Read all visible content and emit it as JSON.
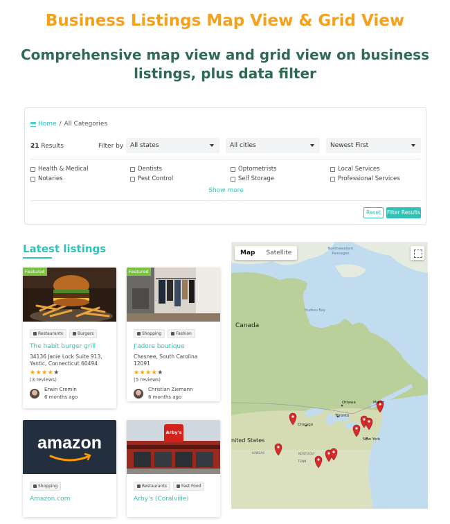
{
  "hero": {
    "title": "Business Listings Map View & Grid View",
    "subtitle": "Comprehensive map view and grid view on business listings, plus data filter"
  },
  "breadcrumb": {
    "home": "Home",
    "separator": "/",
    "current": "All Categories"
  },
  "filter": {
    "results_count": "21",
    "results_label": "Results",
    "filter_by_label": "Filter by",
    "states_value": "All states",
    "cities_value": "All cities",
    "sort_value": "Newest First",
    "categories": [
      "Health & Medical",
      "Dentists",
      "Optometrists",
      "Local Services",
      "Notaries",
      "Pest Control",
      "Self Storage",
      "Professional Services"
    ],
    "show_more": "Show more",
    "reset_label": "Reset",
    "filter_label": "Filter Results"
  },
  "latest": {
    "title": "Latest listings"
  },
  "listings": [
    {
      "featured": "Featured",
      "tags": [
        "Restaurants",
        "Burgers"
      ],
      "name": "The habit burger grill",
      "address": "34136 Janie Lock Suite 913, Yantic, Connecticut 60494",
      "rating": 4,
      "reviews": "(3 reviews)",
      "author": "Erwin Cremin",
      "time": "6 months ago"
    },
    {
      "featured": "Featured",
      "tags": [
        "Shopping",
        "Fashion"
      ],
      "name": "J'adore boutique",
      "address": "Chesnee, South Carolina 12091",
      "rating": 4,
      "reviews": "(5 reviews)",
      "author": "Christian Ziemann",
      "time": "6 months ago"
    },
    {
      "logo_text": "amazon",
      "tags": [
        "Shopping"
      ],
      "name": "Amazon.com"
    },
    {
      "sign_text": "Arby's",
      "tags": [
        "Restaurants",
        "Fast Food"
      ],
      "name": "Arby's (Coralville)"
    }
  ],
  "map": {
    "type_map": "Map",
    "type_satellite": "Satellite",
    "labels": {
      "northwestern_passages": "Northwestern Passages",
      "hudson_bay": "Hudson Bay",
      "canada": "Canada",
      "united_states": "nited States",
      "ottawa": "Ottawa",
      "montreal": "Montr",
      "toronto": "Toronto",
      "chicago": "Chicago",
      "new_york": "New York",
      "kentucky": "KENTUCKY",
      "tennessee": "TENN",
      "kansas": "KANSAS"
    },
    "marker_color": "#d92b2b"
  },
  "colors": {
    "accent": "#30c2b4",
    "title_orange": "#f4a11d",
    "subtitle_green": "#2f6b53",
    "featured": "#7cbf44"
  }
}
